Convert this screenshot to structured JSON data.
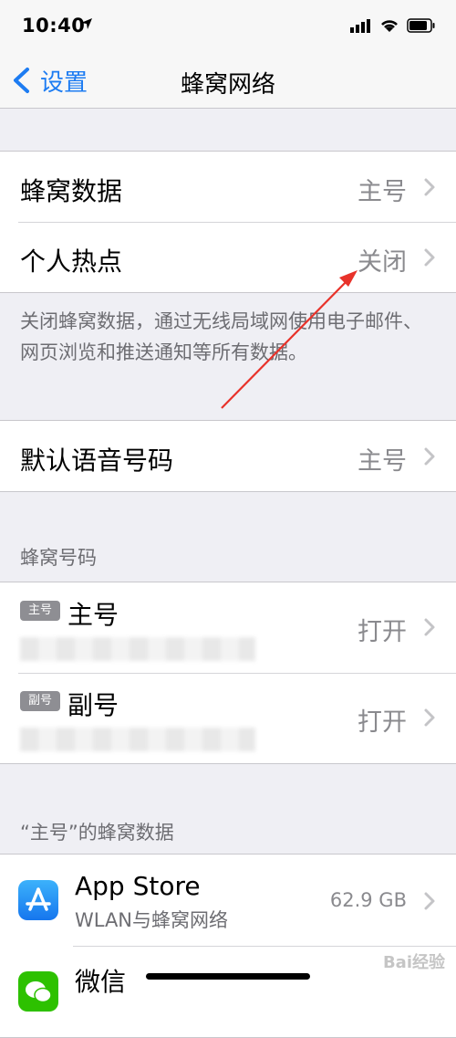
{
  "status_bar": {
    "time": "10:40"
  },
  "nav": {
    "back_label": "设置",
    "title": "蜂窝网络"
  },
  "group1": {
    "rows": [
      {
        "label": "蜂窝数据",
        "value": "主号"
      },
      {
        "label": "个人热点",
        "value": "关闭"
      }
    ],
    "footnote": "关闭蜂窝数据，通过无线局域网使用电子邮件、网页浏览和推送通知等所有数据。"
  },
  "group2": {
    "rows": [
      {
        "label": "默认语音号码",
        "value": "主号"
      }
    ]
  },
  "sim_section": {
    "header": "蜂窝号码",
    "lines": [
      {
        "badge": "主号",
        "name": "主号",
        "value": "打开"
      },
      {
        "badge": "副号",
        "name": "副号",
        "value": "打开"
      }
    ]
  },
  "apps_section": {
    "header": "“主号”的蜂窝数据",
    "apps": [
      {
        "name": "App Store",
        "subtitle": "WLAN与蜂窝网络",
        "size": "62.9 GB",
        "icon": "app-store-icon"
      },
      {
        "name": "微信",
        "subtitle": "",
        "size": "",
        "icon": "wechat-icon"
      }
    ]
  },
  "watermark": "Bai经验"
}
